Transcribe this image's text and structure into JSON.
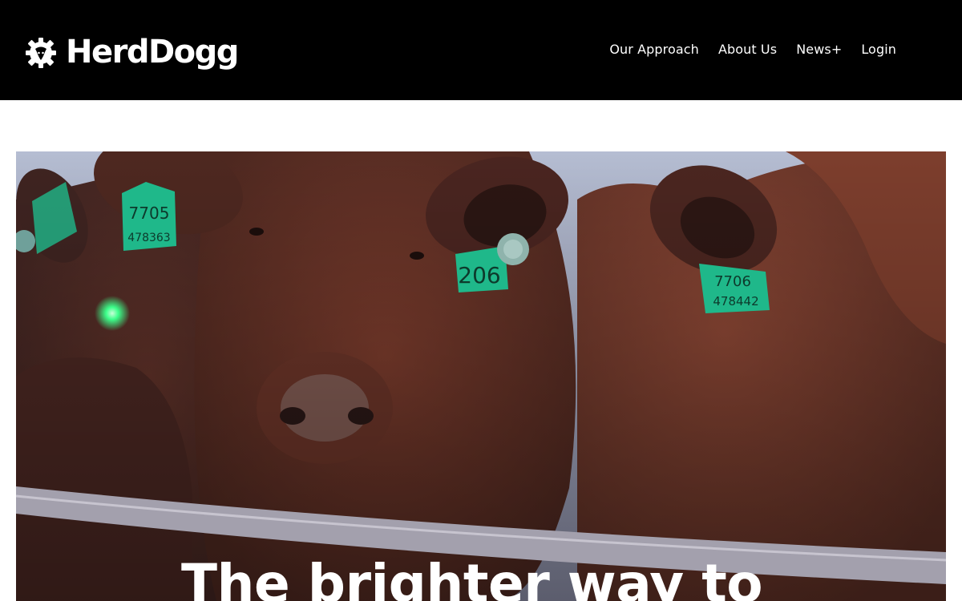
{
  "brand": {
    "name": "HerdDogg",
    "logo_icon": "gear-cow-icon"
  },
  "nav": {
    "items": [
      {
        "label": "Our Approach"
      },
      {
        "label": "About Us"
      },
      {
        "label": "News+"
      },
      {
        "label": "Login"
      }
    ]
  },
  "hero": {
    "heading": "The brighter way to",
    "image": "red cattle behind a metal fence wearing green ear tags",
    "ear_tags": [
      "7705",
      "478363",
      "206",
      "478442"
    ]
  },
  "colors": {
    "topbar": "#000000",
    "text": "#ffffff",
    "ear_tag": "#1fb88a",
    "led": "#3cff8a"
  }
}
